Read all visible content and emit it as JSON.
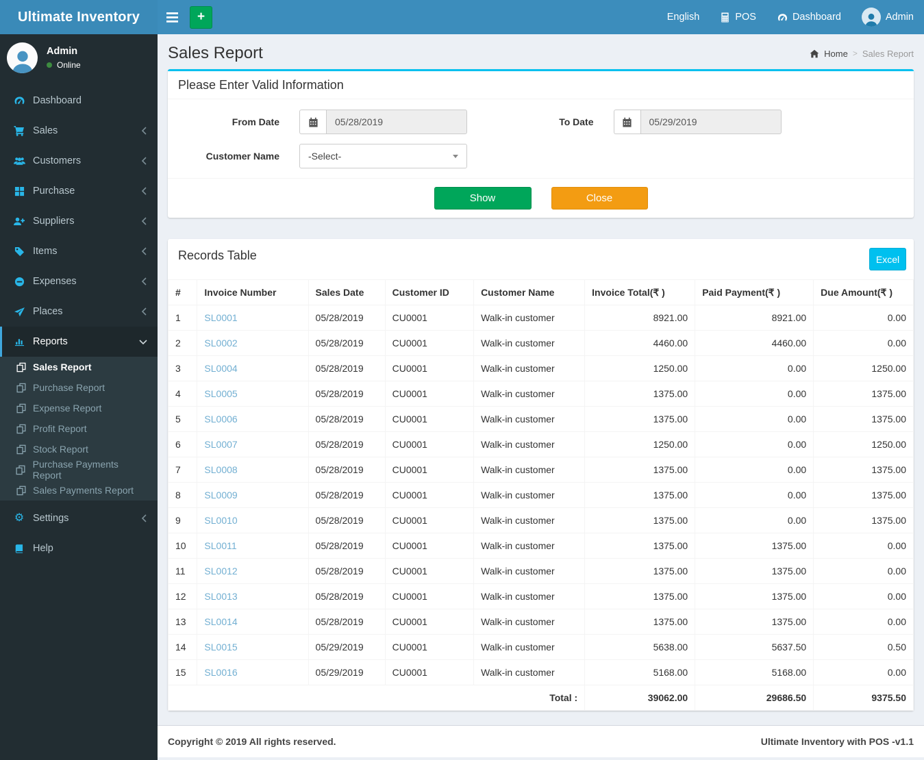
{
  "brand": {
    "title": "Ultimate Inventory"
  },
  "navbar": {
    "language": "English",
    "pos_label": "POS",
    "dashboard_label": "Dashboard",
    "user_label": "Admin",
    "hamburger_icon": "bars-icon",
    "add_button": "+"
  },
  "sidebar": {
    "user": {
      "name": "Admin",
      "status": "Online"
    },
    "menu": [
      {
        "label": "Dashboard",
        "icon": "tachometer-icon"
      },
      {
        "label": "Sales",
        "icon": "cart-icon"
      },
      {
        "label": "Customers",
        "icon": "users-icon"
      },
      {
        "label": "Purchase",
        "icon": "grid-icon"
      },
      {
        "label": "Suppliers",
        "icon": "user-plus-icon"
      },
      {
        "label": "Items",
        "icon": "tag-icon"
      },
      {
        "label": "Expenses",
        "icon": "minus-circle-icon"
      },
      {
        "label": "Places",
        "icon": "paper-plane-icon"
      },
      {
        "label": "Reports",
        "icon": "bar-chart-icon"
      }
    ],
    "submenu": [
      {
        "label": "Sales Report",
        "active": true
      },
      {
        "label": "Purchase Report"
      },
      {
        "label": "Expense Report"
      },
      {
        "label": "Profit Report"
      },
      {
        "label": "Stock Report"
      },
      {
        "label": "Purchase Payments Report"
      },
      {
        "label": "Sales Payments Report"
      }
    ],
    "settings_label": "Settings",
    "help_label": "Help"
  },
  "page": {
    "title": "Sales Report",
    "breadcrumb_home": "Home",
    "breadcrumb_current": "Sales Report"
  },
  "filter": {
    "title": "Please Enter Valid Information",
    "from_label": "From Date",
    "from_value": "05/28/2019",
    "to_label": "To Date",
    "to_value": "05/29/2019",
    "customer_label": "Customer Name",
    "customer_value": "-Select-",
    "show_label": "Show",
    "close_label": "Close"
  },
  "records": {
    "title": "Records Table",
    "excel_label": "Excel",
    "columns": [
      "#",
      "Invoice Number",
      "Sales Date",
      "Customer ID",
      "Customer Name",
      "Invoice Total(₹ )",
      "Paid Payment(₹ )",
      "Due Amount(₹ )"
    ],
    "rows": [
      {
        "no": "1",
        "invoice": "SL0001",
        "date": "05/28/2019",
        "cid": "CU0001",
        "cname": "Walk-in customer",
        "total": "8921.00",
        "paid": "8921.00",
        "due": "0.00"
      },
      {
        "no": "2",
        "invoice": "SL0002",
        "date": "05/28/2019",
        "cid": "CU0001",
        "cname": "Walk-in customer",
        "total": "4460.00",
        "paid": "4460.00",
        "due": "0.00"
      },
      {
        "no": "3",
        "invoice": "SL0004",
        "date": "05/28/2019",
        "cid": "CU0001",
        "cname": "Walk-in customer",
        "total": "1250.00",
        "paid": "0.00",
        "due": "1250.00"
      },
      {
        "no": "4",
        "invoice": "SL0005",
        "date": "05/28/2019",
        "cid": "CU0001",
        "cname": "Walk-in customer",
        "total": "1375.00",
        "paid": "0.00",
        "due": "1375.00"
      },
      {
        "no": "5",
        "invoice": "SL0006",
        "date": "05/28/2019",
        "cid": "CU0001",
        "cname": "Walk-in customer",
        "total": "1375.00",
        "paid": "0.00",
        "due": "1375.00"
      },
      {
        "no": "6",
        "invoice": "SL0007",
        "date": "05/28/2019",
        "cid": "CU0001",
        "cname": "Walk-in customer",
        "total": "1250.00",
        "paid": "0.00",
        "due": "1250.00"
      },
      {
        "no": "7",
        "invoice": "SL0008",
        "date": "05/28/2019",
        "cid": "CU0001",
        "cname": "Walk-in customer",
        "total": "1375.00",
        "paid": "0.00",
        "due": "1375.00"
      },
      {
        "no": "8",
        "invoice": "SL0009",
        "date": "05/28/2019",
        "cid": "CU0001",
        "cname": "Walk-in customer",
        "total": "1375.00",
        "paid": "0.00",
        "due": "1375.00"
      },
      {
        "no": "9",
        "invoice": "SL0010",
        "date": "05/28/2019",
        "cid": "CU0001",
        "cname": "Walk-in customer",
        "total": "1375.00",
        "paid": "0.00",
        "due": "1375.00"
      },
      {
        "no": "10",
        "invoice": "SL0011",
        "date": "05/28/2019",
        "cid": "CU0001",
        "cname": "Walk-in customer",
        "total": "1375.00",
        "paid": "1375.00",
        "due": "0.00"
      },
      {
        "no": "11",
        "invoice": "SL0012",
        "date": "05/28/2019",
        "cid": "CU0001",
        "cname": "Walk-in customer",
        "total": "1375.00",
        "paid": "1375.00",
        "due": "0.00"
      },
      {
        "no": "12",
        "invoice": "SL0013",
        "date": "05/28/2019",
        "cid": "CU0001",
        "cname": "Walk-in customer",
        "total": "1375.00",
        "paid": "1375.00",
        "due": "0.00"
      },
      {
        "no": "13",
        "invoice": "SL0014",
        "date": "05/28/2019",
        "cid": "CU0001",
        "cname": "Walk-in customer",
        "total": "1375.00",
        "paid": "1375.00",
        "due": "0.00"
      },
      {
        "no": "14",
        "invoice": "SL0015",
        "date": "05/29/2019",
        "cid": "CU0001",
        "cname": "Walk-in customer",
        "total": "5638.00",
        "paid": "5637.50",
        "due": "0.50"
      },
      {
        "no": "15",
        "invoice": "SL0016",
        "date": "05/29/2019",
        "cid": "CU0001",
        "cname": "Walk-in customer",
        "total": "5168.00",
        "paid": "5168.00",
        "due": "0.00"
      }
    ],
    "total_label": "Total :",
    "total_invoice": "39062.00",
    "total_paid": "29686.50",
    "total_due": "9375.50"
  },
  "footer": {
    "left": "Copyright © 2019 All rights reserved.",
    "right": "Ultimate Inventory with POS -v1.1"
  },
  "colors": {
    "navbar_blue": "#3c8dbc",
    "sidebar_dark": "#222d32",
    "submenu_dark": "#2c3b41",
    "icon_cyan": "#29b6e8",
    "panel_accent_cyan": "#00c0ef",
    "excel_button_cyan": "#00c0ef",
    "show_button_green": "#00a65a",
    "close_button_orange": "#f39c12",
    "link_light_blue": "#72afd2",
    "online_dot_green": "#3d8b40",
    "body_background": "#ecf0f5"
  }
}
